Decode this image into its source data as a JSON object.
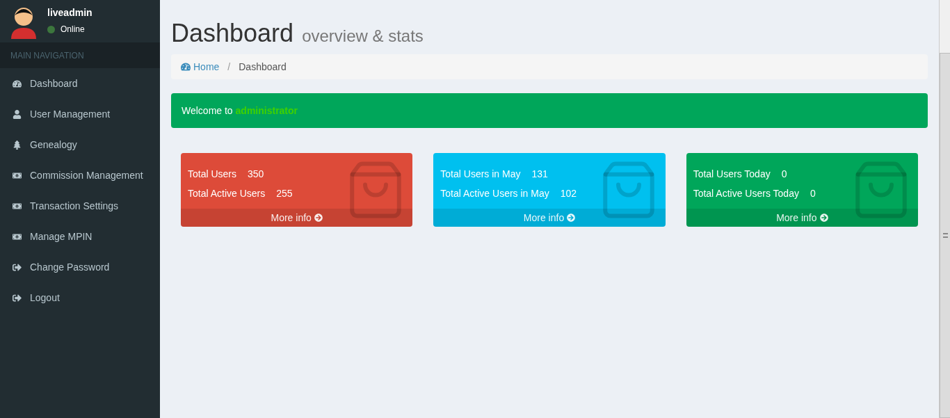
{
  "user": {
    "name": "liveadmin",
    "status": "Online",
    "online": true
  },
  "sidebar": {
    "header": "MAIN NAVIGATION",
    "items": [
      {
        "label": "Dashboard",
        "kind": "dashboard"
      },
      {
        "label": "User Management",
        "kind": "user"
      },
      {
        "label": "Genealogy",
        "kind": "tree"
      },
      {
        "label": "Commission Management",
        "kind": "money"
      },
      {
        "label": "Transaction Settings",
        "kind": "money"
      },
      {
        "label": "Manage MPIN",
        "kind": "money"
      },
      {
        "label": "Change Password",
        "kind": "signout"
      },
      {
        "label": "Logout",
        "kind": "signout"
      }
    ]
  },
  "page": {
    "title": "Dashboard",
    "subtitle": "overview & stats"
  },
  "breadcrumb": {
    "separator": "/",
    "items": [
      {
        "label": "Home",
        "link": true
      },
      {
        "label": "Dashboard",
        "link": false
      }
    ]
  },
  "welcome": {
    "text": "Welcome to",
    "name": "administrator"
  },
  "cards": [
    {
      "color": "#dd4b39",
      "rows": [
        {
          "label": "Total Users",
          "value": "350"
        },
        {
          "label": "Total Active Users",
          "value": "255"
        }
      ],
      "footer": "More info"
    },
    {
      "color": "#00c0ef",
      "rows": [
        {
          "label": "Total Users in May",
          "value": "131"
        },
        {
          "label": "Total Active Users in May",
          "value": "102"
        }
      ],
      "footer": "More info"
    },
    {
      "color": "#00a65a",
      "rows": [
        {
          "label": "Total Users Today",
          "value": "0"
        },
        {
          "label": "Total Active Users Today",
          "value": "0"
        }
      ],
      "footer": "More info"
    }
  ]
}
